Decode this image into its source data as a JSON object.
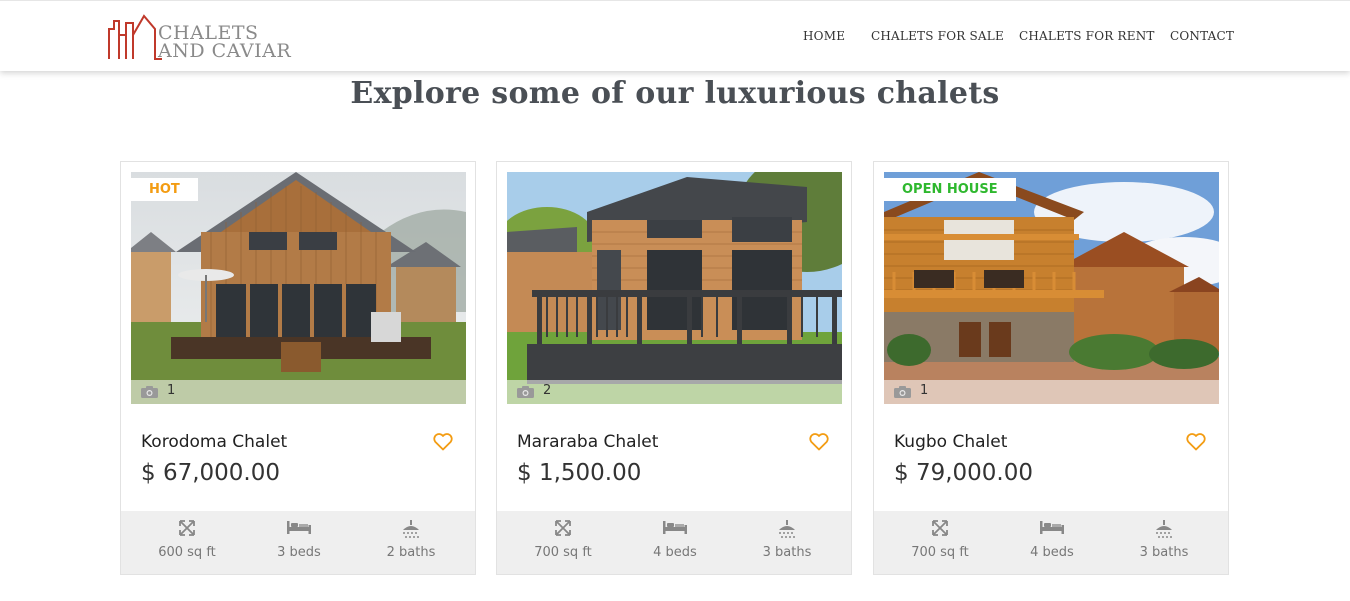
{
  "brand": {
    "line1": "CHALETS",
    "line2": "AND CAVIAR",
    "color": "#c0392b"
  },
  "nav": [
    {
      "label": "HOME"
    },
    {
      "label": "CHALETS FOR SALE"
    },
    {
      "label": "CHALETS FOR RENT"
    },
    {
      "label": "CONTACT"
    }
  ],
  "heading": "Explore some of our luxurious chalets",
  "listings": [
    {
      "badge": "HOT",
      "badge_color": "#f39c12",
      "photo_count": "1",
      "name": "Korodoma Chalet",
      "price": "$ 67,000.00",
      "area": "600 sq ft",
      "beds": "3 beds",
      "baths": "2 baths"
    },
    {
      "badge": "",
      "badge_color": "",
      "photo_count": "2",
      "name": "Mararaba Chalet",
      "price": "$ 1,500.00",
      "area": "700 sq ft",
      "beds": "4 beds",
      "baths": "3 baths"
    },
    {
      "badge": "OPEN HOUSE",
      "badge_color": "#2eb82e",
      "photo_count": "1",
      "name": "Kugbo Chalet",
      "price": "$ 79,000.00",
      "area": "700 sq ft",
      "beds": "4 beds",
      "baths": "3 baths"
    }
  ],
  "icons": {
    "logo": "house-outline-icon",
    "camera": "camera-icon",
    "favorite": "heart-icon",
    "area": "expand-arrows-icon",
    "beds": "bed-icon",
    "baths": "shower-icon"
  },
  "colors": {
    "accent": "#f39c12",
    "heading": "#4a4f55",
    "feature_bg": "#efefef"
  }
}
